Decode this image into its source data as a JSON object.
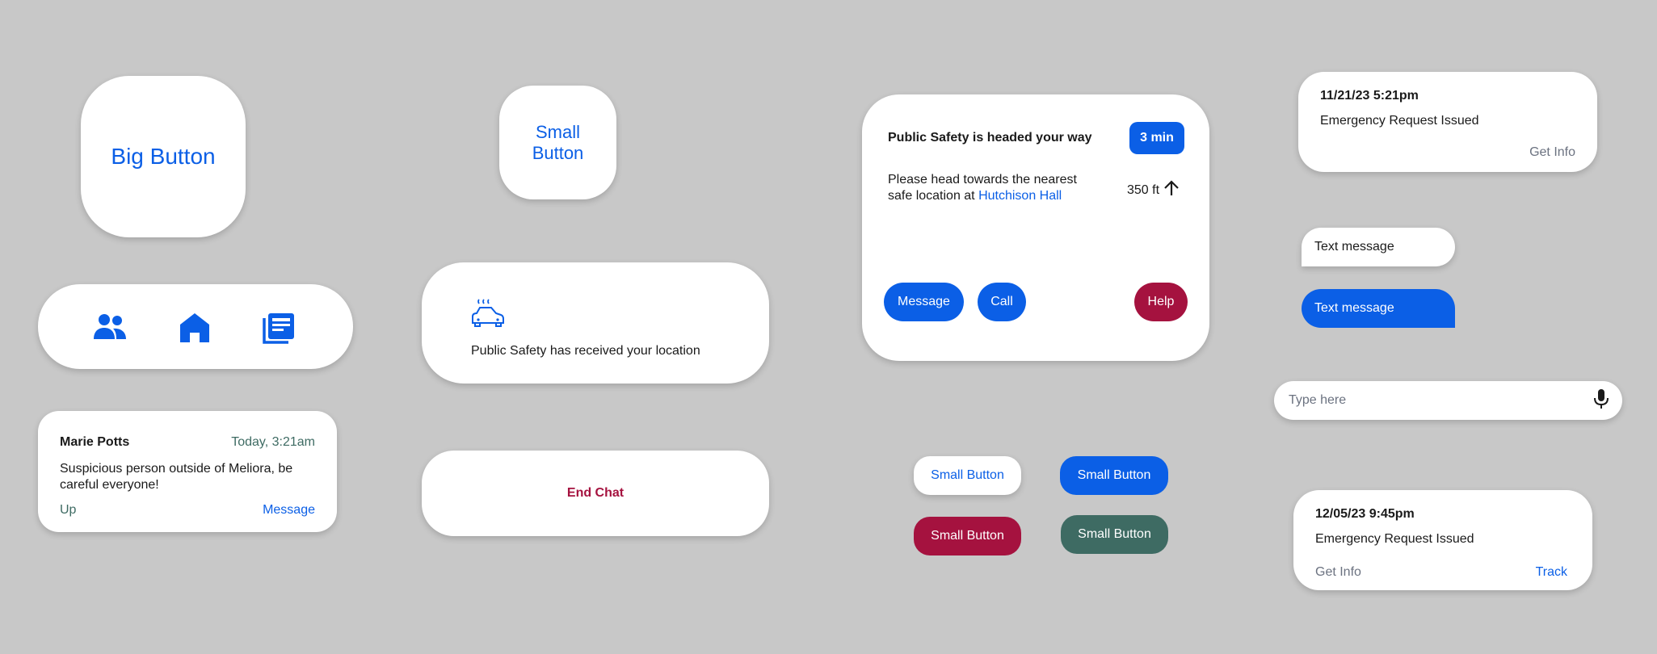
{
  "big_button": {
    "label": "Big Button"
  },
  "small_tile": {
    "label": "Small Button"
  },
  "nav": {
    "icons": [
      "people-icon",
      "home-icon",
      "newspaper-icon"
    ]
  },
  "post": {
    "author": "Marie Potts",
    "time": "Today, 3:21am",
    "body": "Suspicious person outside of Meliora, be careful everyone!",
    "up_label": "Up",
    "message_label": "Message"
  },
  "location_notice": {
    "text": "Public Safety has received your location",
    "icon": "car-icon"
  },
  "end_chat": {
    "label": "End Chat"
  },
  "safety_card": {
    "title": "Public Safety is headed your way",
    "eta": "3 min",
    "instruction": "Please head towards the nearest safe location at ",
    "location_link": "Hutchison Hall",
    "distance": "350 ft",
    "message_label": "Message",
    "call_label": "Call",
    "help_label": "Help"
  },
  "small_buttons": {
    "white": "Small Button",
    "blue": "Small Button",
    "crimson": "Small Button",
    "green": "Small Button"
  },
  "request_1": {
    "date": "11/21/23 5:21pm",
    "status": "Emergency Request Issued",
    "get_info": "Get Info"
  },
  "messages": {
    "received": "Text message",
    "sent": "Text message"
  },
  "input": {
    "placeholder": "Type here"
  },
  "request_2": {
    "date": "12/05/23 9:45pm",
    "status": "Emergency Request Issued",
    "get_info": "Get Info",
    "track": "Track"
  },
  "colors": {
    "background": "#c8c8c8",
    "blue": "#0b5fe6",
    "crimson": "#a5123f",
    "green": "#3e6b63"
  }
}
